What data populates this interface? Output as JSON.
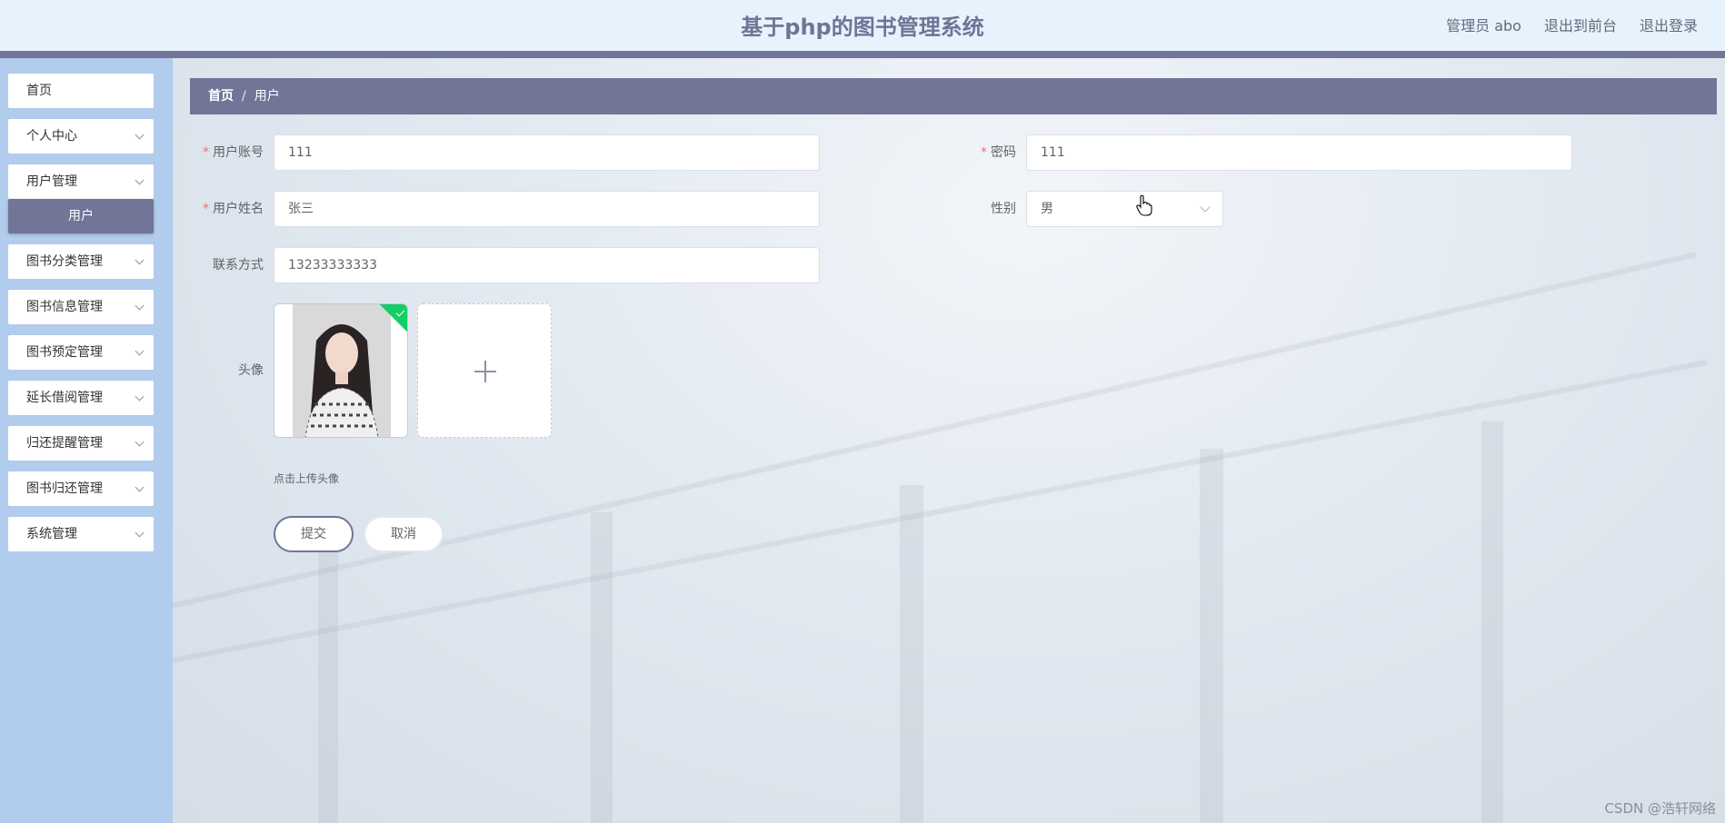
{
  "header": {
    "title": "基于php的图书管理系统",
    "admin": "管理员 abo",
    "to_frontend": "退出到前台",
    "logout": "退出登录"
  },
  "sidebar": {
    "items": [
      {
        "label": "首页",
        "chevron": false
      },
      {
        "label": "个人中心",
        "chevron": true
      },
      {
        "label": "用户管理",
        "chevron": true
      },
      {
        "label": "图书分类管理",
        "chevron": true
      },
      {
        "label": "图书信息管理",
        "chevron": true
      },
      {
        "label": "图书预定管理",
        "chevron": true
      },
      {
        "label": "延长借阅管理",
        "chevron": true
      },
      {
        "label": "归还提醒管理",
        "chevron": true
      },
      {
        "label": "图书归还管理",
        "chevron": true
      },
      {
        "label": "系统管理",
        "chevron": true
      }
    ],
    "active_sub": "用户"
  },
  "breadcrumb": {
    "home": "首页",
    "separator": "/",
    "current": "用户"
  },
  "form": {
    "account": {
      "label": "用户账号",
      "value": "111",
      "required": true
    },
    "password": {
      "label": "密码",
      "value": "111",
      "required": true
    },
    "name": {
      "label": "用户姓名",
      "value": "张三",
      "required": true
    },
    "gender": {
      "label": "性别",
      "value": "男"
    },
    "phone": {
      "label": "联系方式",
      "value": "13233333333"
    },
    "avatar": {
      "label": "头像",
      "hint": "点击上传头像"
    },
    "submit": "提交",
    "cancel": "取消"
  },
  "watermark": "CSDN @浩轩网络",
  "icons": {
    "add": "plus-icon",
    "uploaded": "check-icon",
    "dropdown": "chevron-down-icon",
    "cursor": "hand-pointer-icon"
  },
  "colors": {
    "accent": "#717597",
    "sidebar": "#b1ccec",
    "header": "#e6f3fc",
    "success": "#13ce66",
    "required": "#f56c6c"
  }
}
